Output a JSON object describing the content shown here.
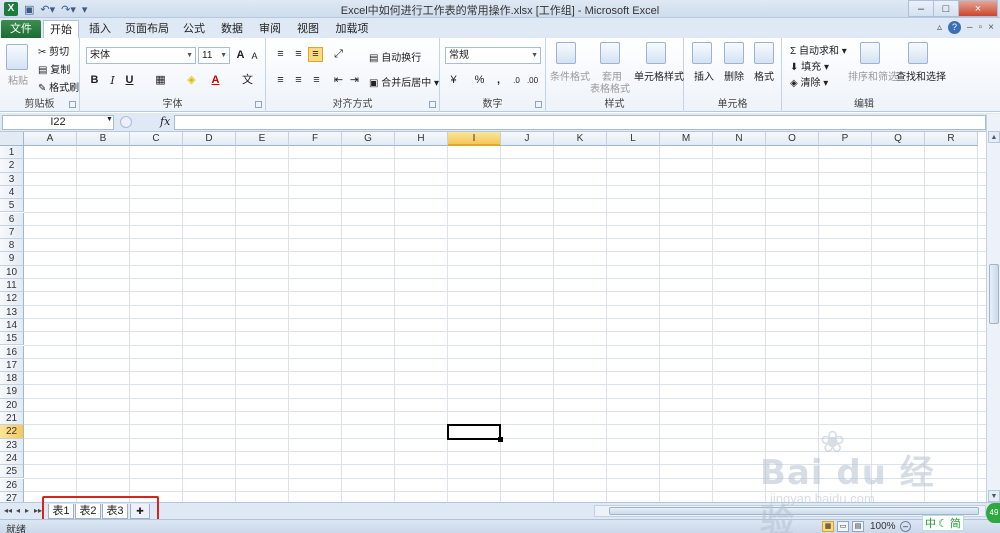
{
  "window": {
    "title": "Excel中如何进行工作表的常用操作.xlsx  [工作组]  -  Microsoft Excel",
    "app_icon": "X",
    "controls": [
      "–",
      "□",
      "×"
    ]
  },
  "quick_access": {
    "icons": [
      "save-icon",
      "undo-icon",
      "redo-icon",
      "customize-icon"
    ]
  },
  "tabs": {
    "file": "文件",
    "items": [
      "开始",
      "插入",
      "页面布局",
      "公式",
      "数据",
      "审阅",
      "视图",
      "加载项"
    ],
    "active": "开始"
  },
  "ribbon": {
    "clipboard": {
      "label": "剪贴板",
      "paste": "粘贴",
      "cut": "剪切",
      "copy": "复制",
      "format_painter": "格式刷"
    },
    "font": {
      "label": "字体",
      "name": "宋体",
      "size": "11",
      "bold": "B",
      "italic": "I",
      "underline": "U",
      "grow": "A",
      "shrink": "A",
      "font_color": "A",
      "wen": "文"
    },
    "alignment": {
      "label": "对齐方式",
      "wrap": "自动换行",
      "merge": "合并后居中"
    },
    "number": {
      "label": "数字",
      "format": "常规",
      "percent": "%",
      "comma": ","
    },
    "styles": {
      "label": "样式",
      "conditional": "条件格式",
      "table1": "套用",
      "table2": "表格格式",
      "cell_styles": "单元格样式"
    },
    "cells": {
      "label": "单元格",
      "insert": "插入",
      "delete": "删除",
      "format": "格式"
    },
    "editing": {
      "label": "编辑",
      "autosum": "自动求和",
      "fill": "填充",
      "clear": "清除",
      "sort": "排序和筛选",
      "find": "查找和选择"
    }
  },
  "formula_bar": {
    "name_box": "I22",
    "fx": "fx",
    "value": ""
  },
  "sheet": {
    "columns": [
      "A",
      "B",
      "C",
      "D",
      "E",
      "F",
      "G",
      "H",
      "I",
      "J",
      "K",
      "L",
      "M",
      "N",
      "O",
      "P",
      "Q",
      "R"
    ],
    "rows": [
      "1",
      "2",
      "3",
      "4",
      "5",
      "6",
      "7",
      "8",
      "9",
      "10",
      "11",
      "12",
      "13",
      "14",
      "15",
      "16",
      "17",
      "18",
      "19",
      "20",
      "21",
      "22",
      "23",
      "24",
      "25",
      "26",
      "27"
    ],
    "active_column": "I",
    "active_row": "22"
  },
  "sheet_tabs": [
    "表1",
    "表2",
    "表3"
  ],
  "status": {
    "ready": "就绪",
    "zoom": "100%"
  },
  "watermark": {
    "logo": "Bai du 经验",
    "url": "jingyan.baidu.com"
  },
  "ime": {
    "label": "中",
    "mode": "简"
  },
  "badge": "49"
}
